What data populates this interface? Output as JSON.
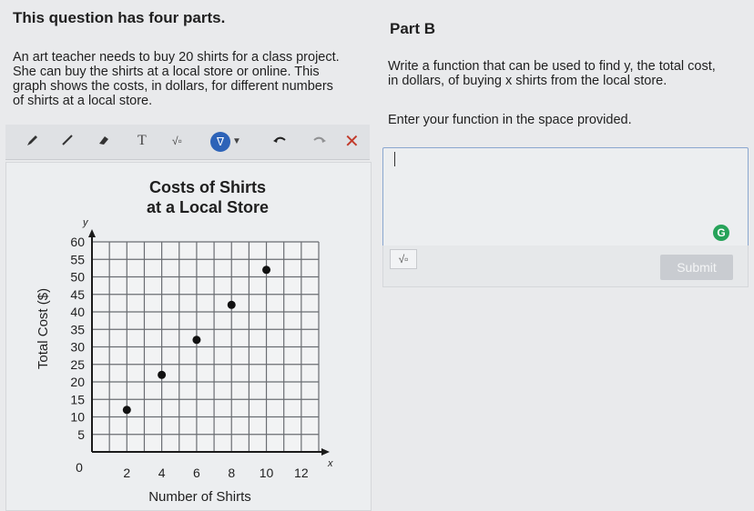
{
  "left": {
    "heading": "This question has four parts.",
    "prompt": [
      "An art teacher needs to buy 20 shirts for a class project.",
      "She can buy the shirts at a local store or online. This",
      "graph shows the costs, in dollars, for different numbers",
      "of shirts at a local store."
    ]
  },
  "right": {
    "heading": "Part B",
    "instruction_lines": [
      "Write a function that can be used to find y, the total cost,",
      "in dollars, of buying x shirts from the local store."
    ],
    "enter_text": "Enter your function in the space provided.",
    "submit_label": "Submit",
    "sqrt_label": "√▫",
    "g_icon": "G"
  },
  "toolbar": {
    "icons": [
      "pencil-icon",
      "line-icon",
      "eraser-icon",
      "text-icon",
      "sqrt-icon",
      "stamp-icon",
      "undo-icon",
      "redo-icon",
      "clear-icon"
    ],
    "text_tool": "T",
    "sqrt_tool": "√▫",
    "stamp_tool": "ᐁ",
    "clear_tool": "✕",
    "accent": "#2d63b8",
    "clear_color": "#c23b2b"
  },
  "chart_data": {
    "type": "scatter",
    "title_lines": [
      "Costs of Shirts",
      "at a Local Store"
    ],
    "xlabel": "Number of Shirts",
    "ylabel": "Total Cost ($)",
    "x_axis_letter": "x",
    "y_axis_letter": "y",
    "xlim": [
      0,
      13
    ],
    "ylim": [
      0,
      60
    ],
    "xticks": [
      2,
      4,
      6,
      8,
      10,
      12
    ],
    "yticks": [
      5,
      10,
      15,
      20,
      25,
      30,
      35,
      40,
      45,
      50,
      55,
      60
    ],
    "origin_label": "0",
    "grid": true,
    "points": [
      {
        "x": 2,
        "y": 12
      },
      {
        "x": 4,
        "y": 22
      },
      {
        "x": 6,
        "y": 32
      },
      {
        "x": 8,
        "y": 42
      },
      {
        "x": 10,
        "y": 52
      }
    ]
  }
}
